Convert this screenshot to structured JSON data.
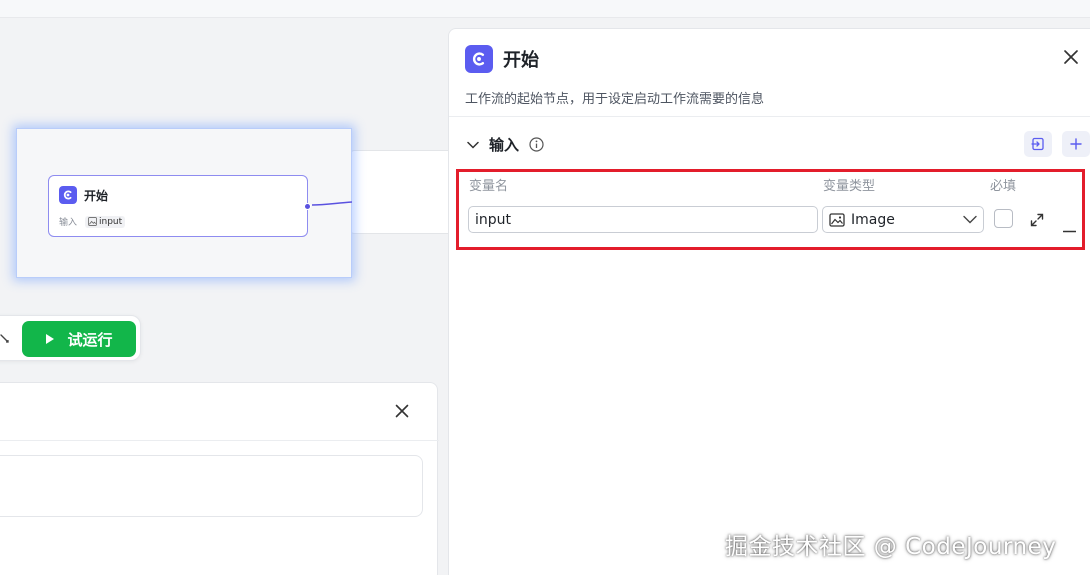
{
  "canvas": {
    "start_node": {
      "title": "开始",
      "input_label": "输入",
      "input_chip": "input"
    },
    "run_bar": {
      "run_label": "试运行"
    }
  },
  "panel": {
    "title": "开始",
    "description": "工作流的起始节点，用于设定启动工作流需要的信息",
    "section": {
      "label": "输入"
    },
    "columns": {
      "name": "变量名",
      "type": "变量类型",
      "required": "必填"
    },
    "rows": [
      {
        "name_value": "input",
        "type_value": "Image",
        "required": false
      }
    ]
  },
  "watermark": "掘金技术社区 @ CodeJourney",
  "colors": {
    "brand": "#5b5cf0",
    "run_green": "#12b64a",
    "highlight_red": "#e31d2b"
  },
  "icons": [
    "start-logo-icon",
    "image-icon",
    "play-icon",
    "close-icon",
    "chevron-down-icon",
    "info-icon",
    "import-icon",
    "plus-icon",
    "expand-icon",
    "minus-icon",
    "tool-icon"
  ]
}
